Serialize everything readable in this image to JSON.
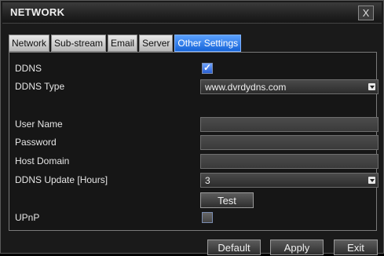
{
  "window": {
    "title": "NETWORK",
    "close_label": "X"
  },
  "tabs": [
    {
      "label": "Network",
      "active": false
    },
    {
      "label": "Sub-stream",
      "active": false
    },
    {
      "label": "Email",
      "active": false
    },
    {
      "label": "Server",
      "active": false
    },
    {
      "label": "Other Settings",
      "active": true
    }
  ],
  "form": {
    "ddns": {
      "label": "DDNS",
      "checked": true
    },
    "ddns_type": {
      "label": "DDNS Type",
      "value": "www.dvrdydns.com"
    },
    "user_name": {
      "label": "User Name",
      "value": ""
    },
    "password": {
      "label": "Password",
      "value": ""
    },
    "host_domain": {
      "label": "Host Domain",
      "value": ""
    },
    "ddns_update": {
      "label": "DDNS Update [Hours]",
      "value": "3"
    },
    "test_label": "Test",
    "upnp": {
      "label": "UPnP",
      "checked": false
    }
  },
  "footer": {
    "default_label": "Default",
    "apply_label": "Apply",
    "exit_label": "Exit"
  },
  "colors": {
    "accent": "#1664d8",
    "background": "#161616"
  }
}
